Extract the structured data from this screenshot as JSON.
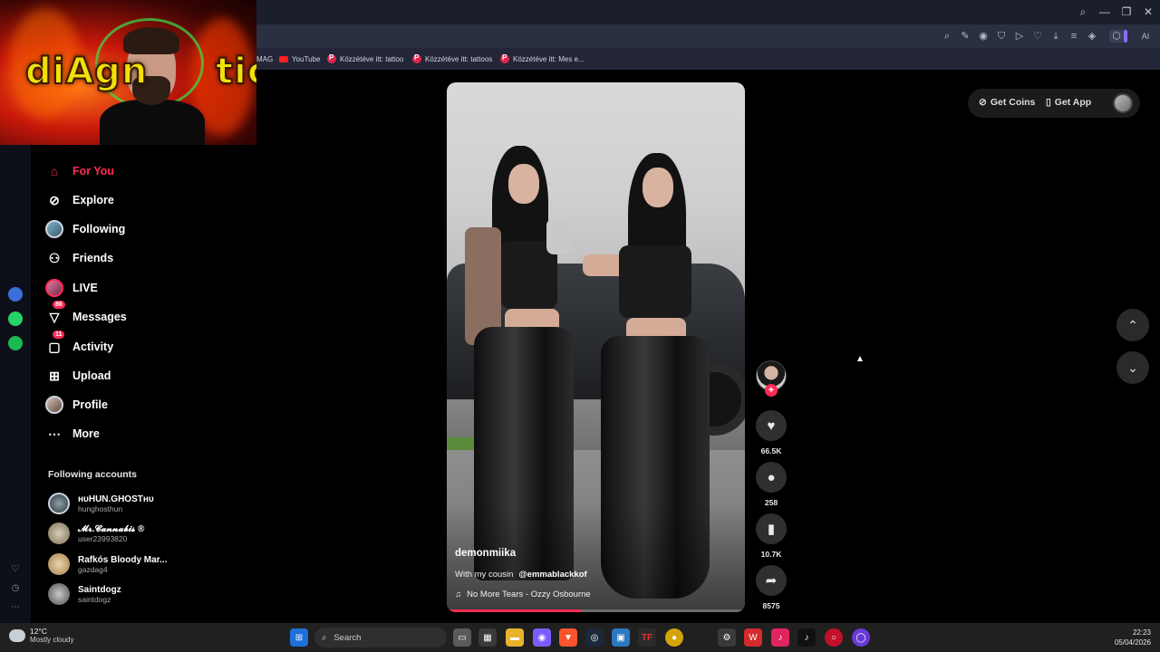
{
  "browser": {
    "bookmarks": [
      "MAG",
      "YouTube",
      "Közzétéve itt: tattoo",
      "Közzétéve itt: tattoos",
      "Közzétéve itt: Mes e..."
    ],
    "ai_label": "AI"
  },
  "webcam": {
    "logo_text": "diAgn     tic"
  },
  "nav": {
    "items": [
      {
        "label": "For You",
        "icon": "home-icon",
        "active": true
      },
      {
        "label": "Explore",
        "icon": "compass-icon"
      },
      {
        "label": "Following",
        "icon": "following-avatar"
      },
      {
        "label": "Friends",
        "icon": "friends-icon"
      },
      {
        "label": "LIVE",
        "icon": "live-avatar"
      },
      {
        "label": "Messages",
        "icon": "messages-icon",
        "badge": "86"
      },
      {
        "label": "Activity",
        "icon": "activity-icon",
        "badge": "11"
      },
      {
        "label": "Upload",
        "icon": "upload-icon"
      },
      {
        "label": "Profile",
        "icon": "profile-avatar"
      },
      {
        "label": "More",
        "icon": "more-icon"
      }
    ],
    "following_title": "Following accounts",
    "accounts": [
      {
        "name": "ʜᴜHUN.GHOSTʜᴜ",
        "username": "hunghosthun"
      },
      {
        "name": "𝓜𝓻.𝓒𝓪𝓷𝓷𝓪𝓫𝓲𝓼 ®",
        "username": "user23993820"
      },
      {
        "name": "Rafkós Bloody Mar...",
        "username": "gazdag4"
      },
      {
        "name": "Saintdogz",
        "username": "saintdogz"
      }
    ]
  },
  "video": {
    "author": "demonmiika",
    "caption": "With my cousin",
    "mention": "@emmablackkof",
    "music": "No More Tears - Ozzy Osbourne",
    "progress_fraction": 0.45
  },
  "actions": {
    "likes": "66.5K",
    "comments": "258",
    "saves": "10.7K",
    "shares": "8575"
  },
  "topright": {
    "coins": "Get Coins",
    "app": "Get App"
  },
  "taskbar": {
    "temp": "12°C",
    "weather": "Mostly cloudy",
    "search": "Search",
    "time": "22:23",
    "date": "05/04/2026"
  },
  "colors": {
    "accent": "#fe2c55",
    "background": "#000000",
    "sidebar_bg": "#0e1019"
  }
}
